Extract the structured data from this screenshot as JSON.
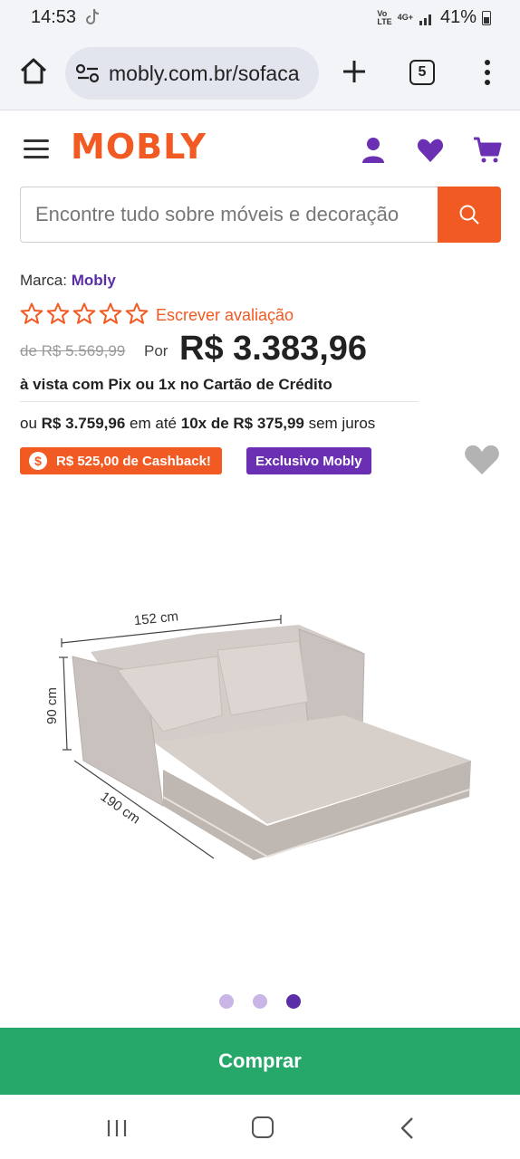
{
  "status_bar": {
    "time": "14:53",
    "battery": "41%",
    "network": "4G+"
  },
  "browser": {
    "url": "mobly.com.br/sofaca",
    "tab_count": "5"
  },
  "header": {
    "logo": "MOBLY"
  },
  "search": {
    "placeholder": "Encontre tudo sobre móveis e decoração"
  },
  "product": {
    "brand_label": "Marca:",
    "brand_name": "Mobly",
    "rating_stars": 0,
    "review_link": "Escrever avaliação",
    "old_price": "de R$ 5.569,99",
    "por": "Por",
    "price": "R$ 3.383,96",
    "payment_note": "à vista com Pix ou 1x no Cartão de Crédito",
    "installments": {
      "prefix": "ou",
      "total": "R$ 3.759,96",
      "middle": "em até",
      "count": "10x de R$ 375,99",
      "suffix": "sem juros"
    },
    "cashback_badge": "R$ 525,00 de Cashback!",
    "cashback_symbol": "$",
    "exclusive_badge": "Exclusivo Mobly"
  },
  "image": {
    "dim_width": "152 cm",
    "dim_height": "90 cm",
    "dim_depth": "190 cm"
  },
  "carousel": {
    "total": 3,
    "active": 3
  },
  "buy_button": "Comprar",
  "colors": {
    "brand_orange": "#f15a22",
    "brand_purple": "#6b2fb4",
    "buy_green": "#27a86b"
  }
}
